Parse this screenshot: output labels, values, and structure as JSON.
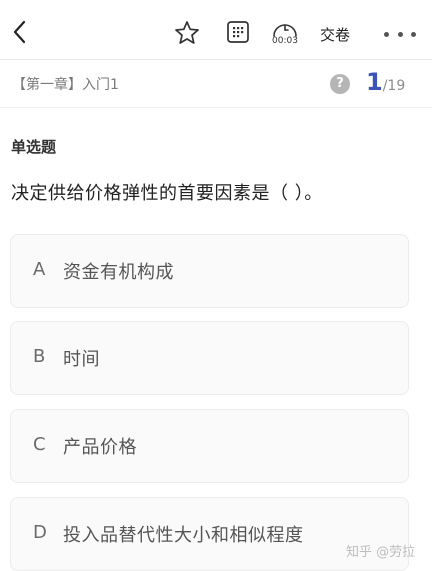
{
  "toolbar": {
    "timer": "00:03",
    "submit_label": "交卷"
  },
  "chapter": {
    "title": "【第一章】入门1",
    "help_label": "?"
  },
  "progress": {
    "current": "1",
    "total": "/19"
  },
  "question": {
    "type": "单选题",
    "text": "决定供给价格弹性的首要因素是（  ）。",
    "options": [
      {
        "letter": "A",
        "text": "资金有机构成"
      },
      {
        "letter": "B",
        "text": "时间"
      },
      {
        "letter": "C",
        "text": "产品价格"
      },
      {
        "letter": "D",
        "text": "投入品替代性大小和相似程度"
      }
    ]
  },
  "watermark": "知乎 @劳拉",
  "colors": {
    "accent": "#3b54b5",
    "option_bg": "#fafafa",
    "muted": "#7a7a7a"
  },
  "icons": [
    "chevron-left-icon",
    "star-icon",
    "answer-sheet-icon",
    "timer-icon",
    "more-dots-icon",
    "help-icon"
  ]
}
